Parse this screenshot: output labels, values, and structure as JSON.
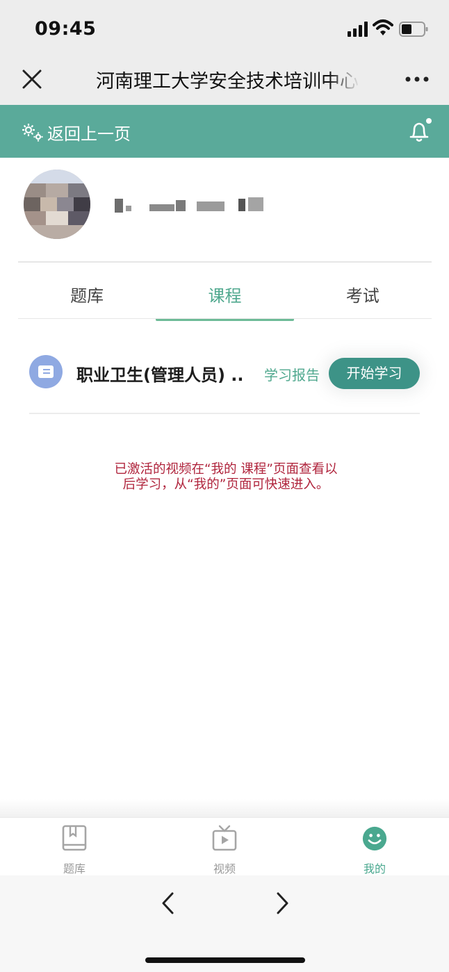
{
  "status_bar": {
    "time": "09:45"
  },
  "header": {
    "title": "河南理工大学安全技术培训中心"
  },
  "toolbar": {
    "back_label": "返回上一页"
  },
  "tabs": [
    {
      "label": "题库",
      "active": false
    },
    {
      "label": "课程",
      "active": true
    },
    {
      "label": "考试",
      "active": false
    }
  ],
  "course": {
    "title": "职业卫生(管理人员) ..",
    "report_label": "学习报告",
    "start_label": "开始学习"
  },
  "notice": "已激活的视频在“我的 课程”页面查看以后学习，从“我的”页面可快速进入。",
  "bottom_nav": [
    {
      "label": "题库",
      "icon": "book-icon",
      "active": false
    },
    {
      "label": "视频",
      "icon": "tv-icon",
      "active": false
    },
    {
      "label": "我的",
      "icon": "smile-icon",
      "active": true
    }
  ],
  "colors": {
    "accent": "#5aaa9a",
    "primary_button": "#3d9387",
    "notice": "#b0253d",
    "course_icon": "#8fa9e2"
  }
}
